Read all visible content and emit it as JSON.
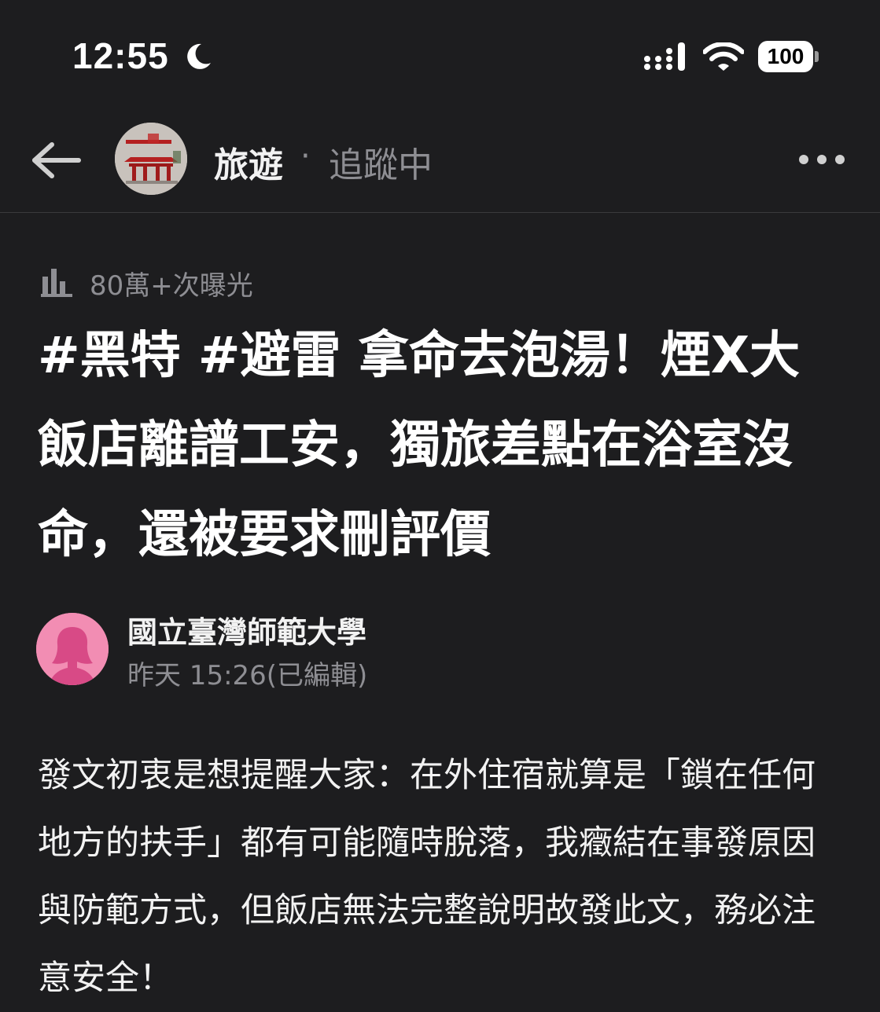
{
  "status_bar": {
    "time": "12:55",
    "battery": "100",
    "icons": [
      "moon-icon",
      "cellular-signal-icon",
      "wifi-icon",
      "battery-icon"
    ]
  },
  "header": {
    "board_name": "旅遊",
    "separator": "·",
    "follow_status": "追蹤中",
    "icons": [
      "back-arrow-icon",
      "more-options-icon"
    ]
  },
  "article": {
    "impressions": "80萬+次曝光",
    "title": "#黑特 #避雷 拿命去泡湯！煙X大飯店離譜工安，獨旅差點在浴室沒命，還被要求刪評價",
    "author": {
      "name": "國立臺灣師範大學",
      "time": "昨天 15:26(已編輯)"
    },
    "body": "發文初衷是想提醒大家：在外住宿就算是「鎖在任何地方的扶手」都有可能隨時脫落，我癥結在事發原因與防範方式，但飯店無法完整說明故發此文，務必注意安全！"
  },
  "colors": {
    "background": "#1d1d1f",
    "text_primary": "#f2f2f2",
    "text_secondary": "#8e8e93",
    "author_avatar": "#f28db3"
  }
}
